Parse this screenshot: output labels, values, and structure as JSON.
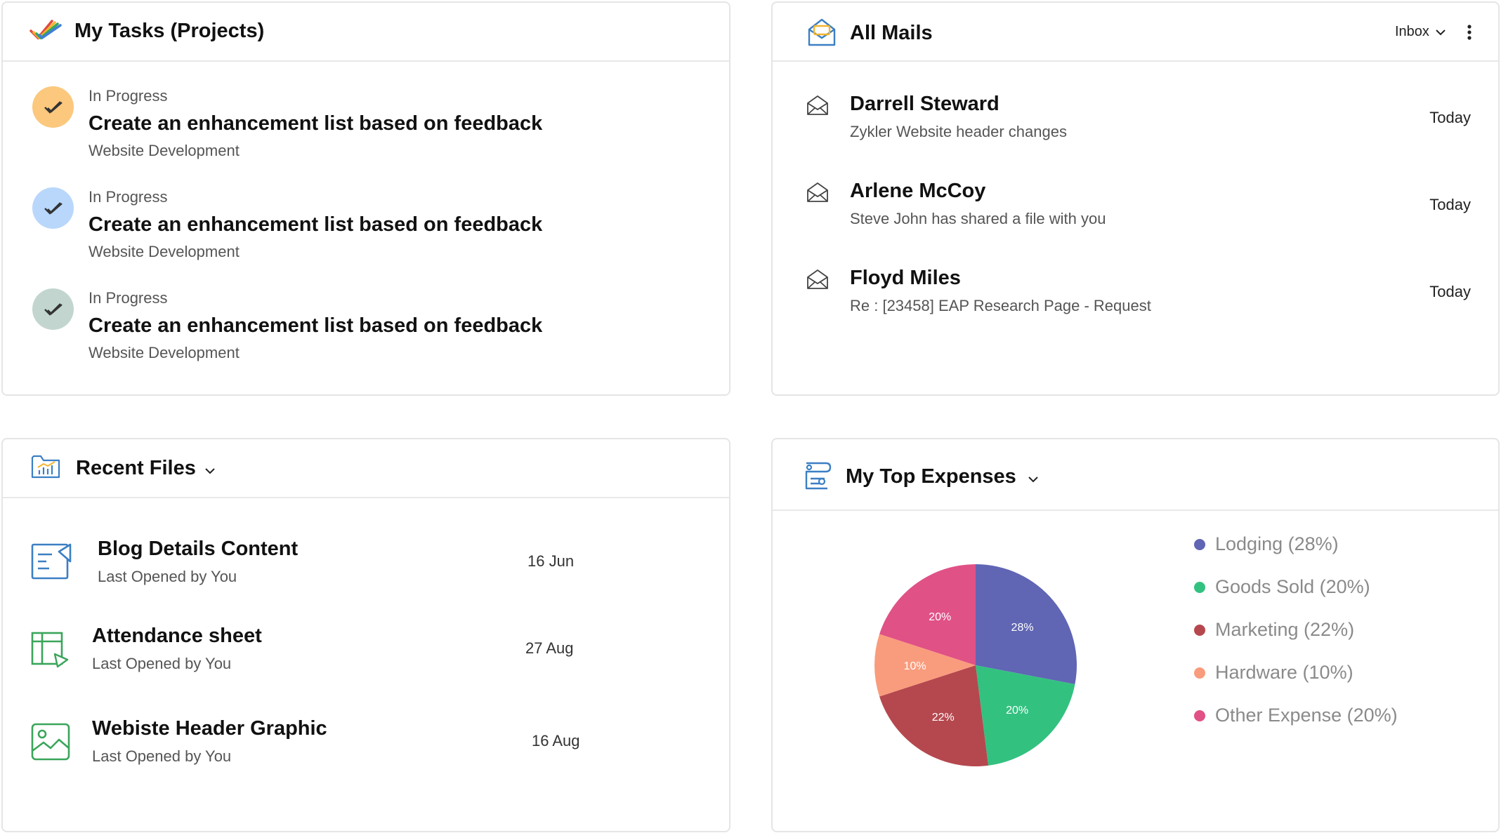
{
  "tasks_card": {
    "title": "My Tasks (Projects)",
    "items": [
      {
        "status": "In Progress",
        "title": "Create an enhancement list based on feedback",
        "project": "Website Development",
        "circle_color": "#fbc87d"
      },
      {
        "status": "In Progress",
        "title": "Create an enhancement list based on feedback",
        "project": "Website Development",
        "circle_color": "#b8d7fb"
      },
      {
        "status": "In Progress",
        "title": "Create an enhancement list based on feedback",
        "project": "Website Development",
        "circle_color": "#c2d6cf"
      }
    ]
  },
  "mails_card": {
    "title": "All Mails",
    "folder_label": "Inbox",
    "items": [
      {
        "sender": "Darrell Steward",
        "subject": "Zykler Website header changes",
        "date": "Today"
      },
      {
        "sender": "Arlene McCoy",
        "subject": "Steve John has shared a file with you",
        "date": "Today"
      },
      {
        "sender": "Floyd Miles",
        "subject": "Re : [23458] EAP Research Page - Request",
        "date": "Today"
      }
    ]
  },
  "files_card": {
    "title": "Recent Files",
    "items": [
      {
        "name": "Blog Details Content",
        "sub": "Last Opened by You",
        "date": "16 Jun",
        "icon": "document-icon"
      },
      {
        "name": "Attendance sheet",
        "sub": "Last Opened by You",
        "date": "27 Aug",
        "icon": "spreadsheet-icon"
      },
      {
        "name": "Webiste Header Graphic",
        "sub": "Last Opened by You",
        "date": "16 Aug",
        "icon": "image-icon"
      }
    ]
  },
  "expenses_card": {
    "title": "My Top Expenses"
  },
  "chart_data": {
    "type": "pie",
    "slices": [
      {
        "name": "Lodging",
        "value": 28,
        "label": "28%",
        "legend": "Lodging (28%)",
        "color": "#6065b4"
      },
      {
        "name": "Goods Sold",
        "value": 20,
        "label": "20%",
        "legend": "Goods Sold (20%)",
        "color": "#33c180"
      },
      {
        "name": "Marketing",
        "value": 22,
        "label": "22%",
        "legend": "Marketing (22%)",
        "color": "#b5484e"
      },
      {
        "name": "Hardware",
        "value": 10,
        "label": "10%",
        "legend": "Hardware (10%)",
        "color": "#f99c7d"
      },
      {
        "name": "Other Expense",
        "value": 20,
        "label": "20%",
        "legend": "Other Expense (20%)",
        "color": "#e05186"
      }
    ],
    "legend_position": "right"
  }
}
